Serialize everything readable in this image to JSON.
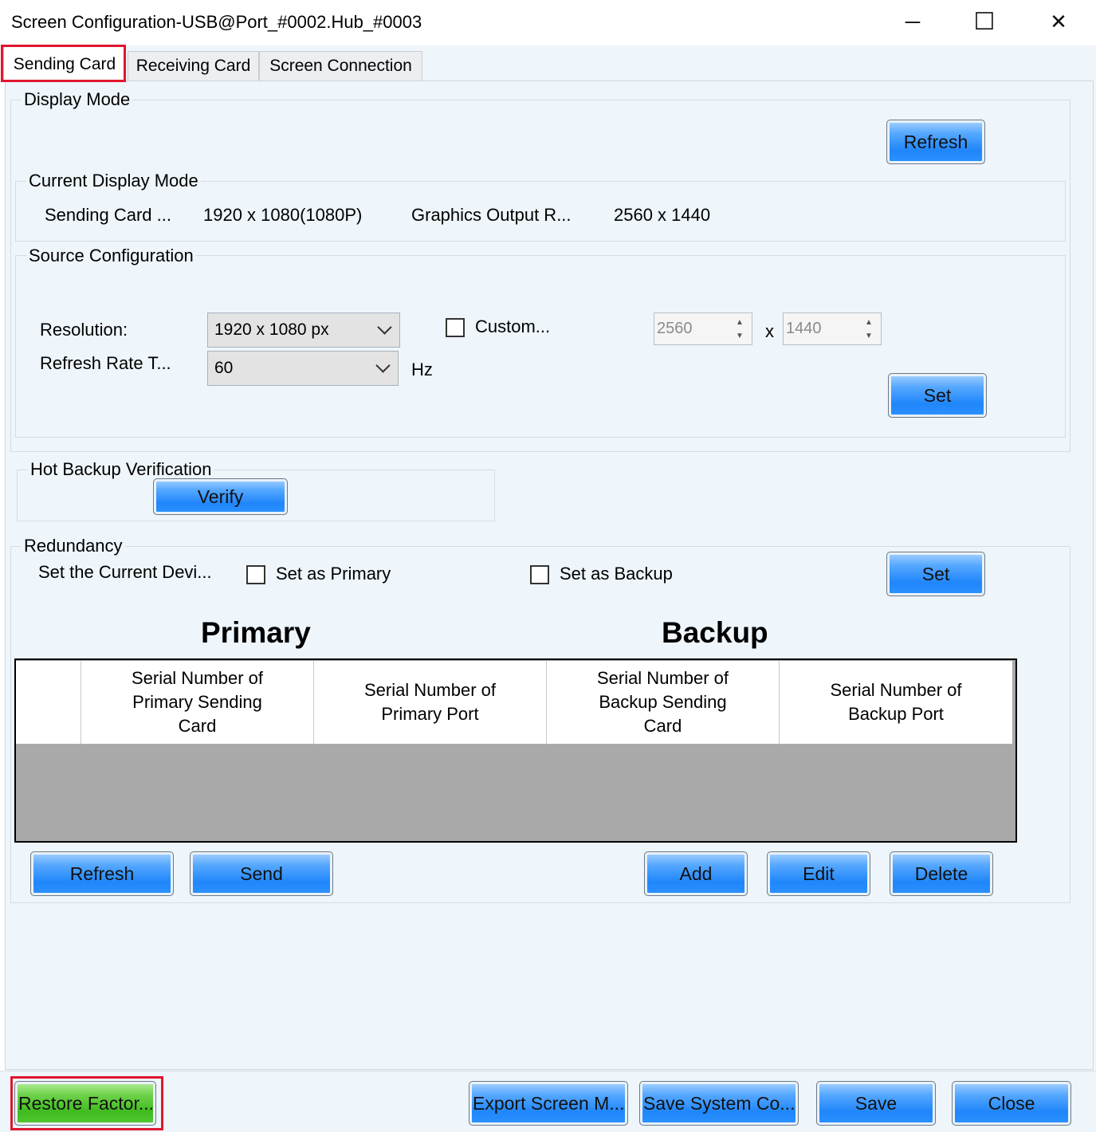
{
  "window": {
    "title": "Screen Configuration-USB@Port_#0002.Hub_#0003",
    "minimize_glyph": "─",
    "maximize_glyph": "☐",
    "close_glyph": "✕"
  },
  "tabs": [
    {
      "label": "Sending Card",
      "active": true
    },
    {
      "label": "Receiving Card",
      "active": false
    },
    {
      "label": "Screen Connection",
      "active": false
    }
  ],
  "display_mode": {
    "label": "Display Mode",
    "refresh_label": "Refresh",
    "current": {
      "label": "Current Display Mode",
      "sending_card_label": "Sending Card ...",
      "sending_card_value": "1920 x 1080(1080P)",
      "graphics_output_label": "Graphics Output R...",
      "graphics_output_value": "2560 x 1440"
    },
    "source": {
      "label": "Source Configuration",
      "resolution_label": "Resolution:",
      "resolution_value": "1920 x 1080 px",
      "custom_label": "Custom...",
      "custom_checked": false,
      "width_value": "2560",
      "times": "x",
      "height_value": "1440",
      "refresh_rate_label": "Refresh Rate T...",
      "refresh_rate_value": "60",
      "hz": "Hz",
      "set_label": "Set"
    }
  },
  "hot_backup": {
    "label": "Hot Backup Verification",
    "verify_label": "Verify"
  },
  "redundancy": {
    "label": "Redundancy",
    "current_device_label": "Set the Current Devi...",
    "set_primary_label": "Set as Primary",
    "set_primary_checked": false,
    "set_backup_label": "Set as Backup",
    "set_backup_checked": false,
    "set_label": "Set",
    "primary_header": "Primary",
    "backup_header": "Backup",
    "columns": [
      "",
      "Serial Number of Primary Sending Card",
      "Serial Number of Primary Port",
      "Serial Number of Backup Sending Card",
      "Serial Number of Backup Port"
    ],
    "rows": [],
    "refresh_label": "Refresh",
    "send_label": "Send",
    "add_label": "Add",
    "edit_label": "Edit",
    "delete_label": "Delete"
  },
  "footer": {
    "restore_label": "Restore Factor...",
    "export_label": "Export Screen M...",
    "save_system_label": "Save System Co...",
    "save_label": "Save",
    "close_label": "Close"
  },
  "colors": {
    "highlight": "#e0162e",
    "button_blue": "#1f86fb",
    "button_green": "#3fbb1f",
    "panel_bg": "#eef5fb",
    "table_empty": "#a9a9a9"
  }
}
